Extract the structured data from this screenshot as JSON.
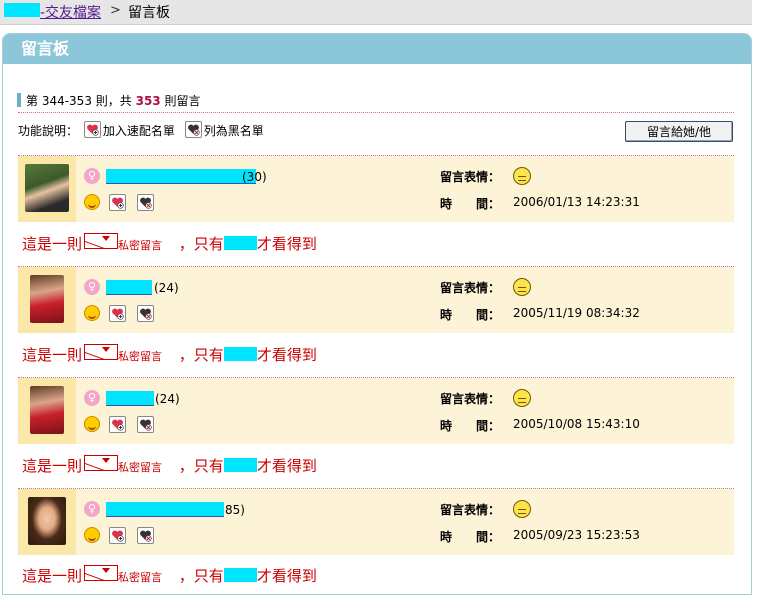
{
  "breadcrumb": {
    "link": "-交友檔案",
    "separator": ">",
    "current": "留言板"
  },
  "panel_title": "留言板",
  "count": {
    "prefix": "第 344-353 則，共",
    "total": "353",
    "suffix": "則留言"
  },
  "legend": {
    "label": "功能說明：",
    "add_speed_list": "加入速配名單",
    "blacklist": "列為黑名單"
  },
  "leave_message_button": "留言給她/他",
  "mood_label": "留言表情：",
  "time_label": "時　　間：",
  "private_note": {
    "prefix": "這是一則",
    "tag": "私密留言",
    "middle": "，只有",
    "suffix": "才看得到"
  },
  "messages": [
    {
      "age": "(30)",
      "time": "2006/01/13 14:23:31"
    },
    {
      "age": "(24)",
      "time": "2005/11/19 08:34:32"
    },
    {
      "age": "(24)",
      "time": "2005/10/08 15:43:10"
    },
    {
      "age": "85)",
      "time": "2005/09/23 15:23:53"
    }
  ],
  "colors": {
    "panel_header": "#8cc7d9",
    "entry_bg": "#fdf3d6",
    "highlight": "#b01040",
    "private_text": "#cc0000",
    "redaction": "#00e5ff"
  },
  "icons": [
    "gender-female-icon",
    "smile-icon",
    "heart-add-icon",
    "heart-block-icon",
    "mood-neutral-icon",
    "envelope-icon"
  ]
}
